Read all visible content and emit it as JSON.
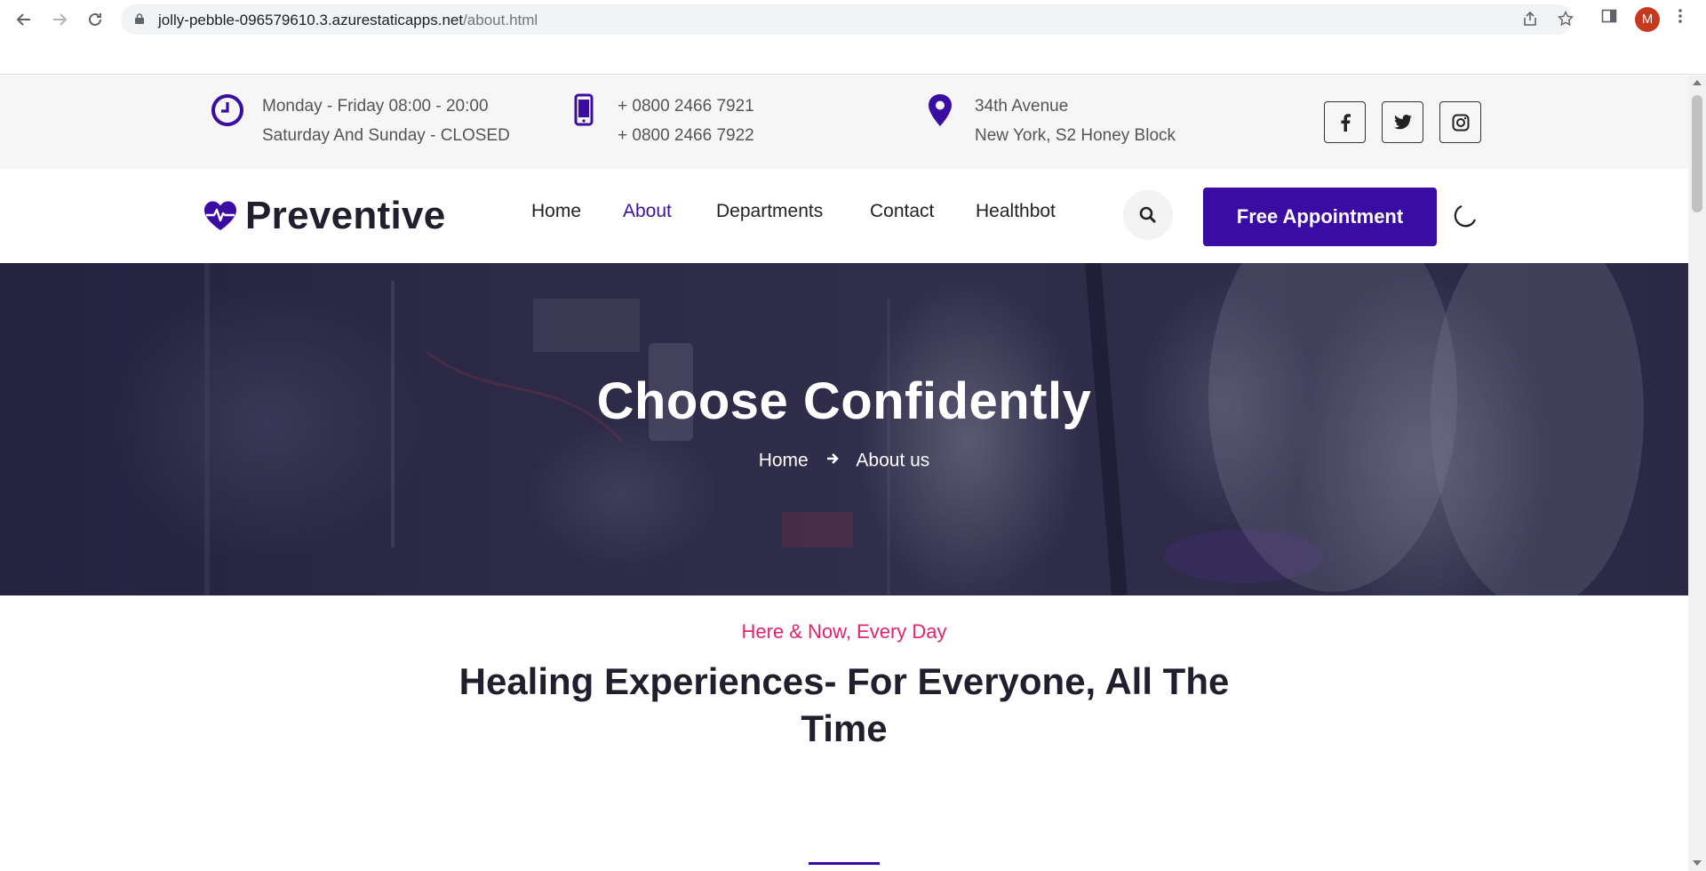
{
  "browser": {
    "url_host": "jolly-pebble-096579610.3.azurestaticapps.net",
    "url_path": "/about.html",
    "profile_initial": "M"
  },
  "topbar": {
    "hours": {
      "line1": "Monday - Friday 08:00 - 20:00",
      "line2": "Saturday And Sunday - CLOSED",
      "icon": "clock-icon"
    },
    "phone": {
      "line1": "+ 0800 2466 7921",
      "line2": "+ 0800 2466 7922",
      "icon": "mobile-phone-icon"
    },
    "address": {
      "line1": "34th Avenue",
      "line2": "New York, S2 Honey Block",
      "icon": "map-pin-icon"
    },
    "social": [
      "facebook-icon",
      "twitter-icon",
      "instagram-icon"
    ]
  },
  "header": {
    "brand": "Preventive",
    "nav": [
      {
        "label": "Home",
        "active": false
      },
      {
        "label": "About",
        "active": true
      },
      {
        "label": "Departments",
        "active": false
      },
      {
        "label": "Contact",
        "active": false
      },
      {
        "label": "Healthbot",
        "active": false
      }
    ],
    "cta": "Free Appointment"
  },
  "hero": {
    "title": "Choose Confidently",
    "breadcrumb": [
      "Home",
      "About us"
    ]
  },
  "intro": {
    "tagline": "Here & Now, Every Day",
    "title": "Healing Experiences- For Everyone, All The Time"
  },
  "colors": {
    "brand": "#3a0ca3",
    "accent": "#e0246f"
  }
}
